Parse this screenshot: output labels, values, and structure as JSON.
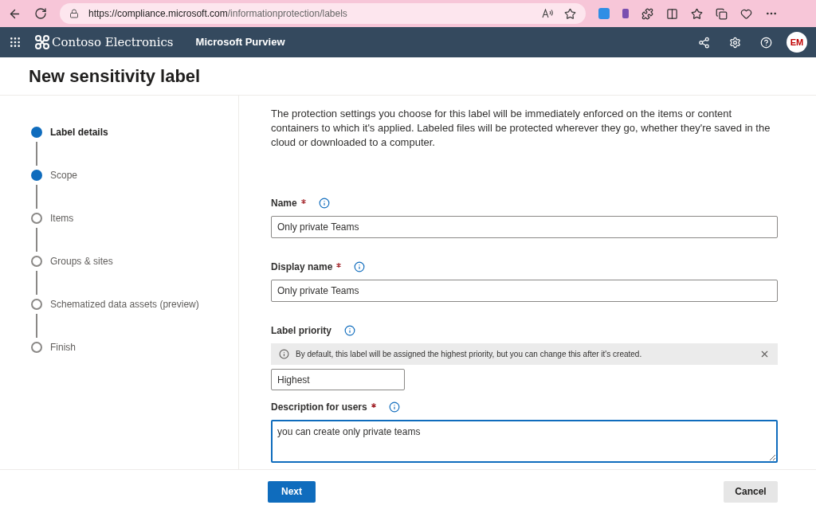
{
  "browser": {
    "url_host": "https://compliance.microsoft.com",
    "url_path": "/informationprotection/labels"
  },
  "header": {
    "org": "Contoso Electronics",
    "product": "Microsoft Purview",
    "avatar": "EM"
  },
  "page_title": "New sensitivity label",
  "steps": [
    {
      "label": "Label details",
      "selected": true,
      "completed": true
    },
    {
      "label": "Scope",
      "selected": false,
      "completed": true
    },
    {
      "label": "Items",
      "selected": false,
      "completed": false
    },
    {
      "label": "Groups & sites",
      "selected": false,
      "completed": false
    },
    {
      "label": "Schematized data assets (preview)",
      "selected": false,
      "completed": false
    },
    {
      "label": "Finish",
      "selected": false,
      "completed": false
    }
  ],
  "intro": "The protection settings you choose for this label will be immediately enforced on the items or content containers to which it's applied. Labeled files will be protected wherever they go, whether they're saved in the cloud or downloaded to a computer.",
  "fields": [
    {
      "kind": "input",
      "label": "Name",
      "required": true,
      "value": "Only private Teams"
    },
    {
      "kind": "input",
      "label": "Display name",
      "required": true,
      "value": "Only private Teams"
    },
    {
      "kind": "priority",
      "label": "Label priority",
      "notice": "By default, this label will be assigned the highest priority, but you can change this after it's created.",
      "value": "Highest"
    },
    {
      "kind": "textarea",
      "label": "Description for users",
      "required": true,
      "value": "you can create only private teams"
    }
  ],
  "footer": {
    "next": "Next",
    "cancel": "Cancel"
  }
}
